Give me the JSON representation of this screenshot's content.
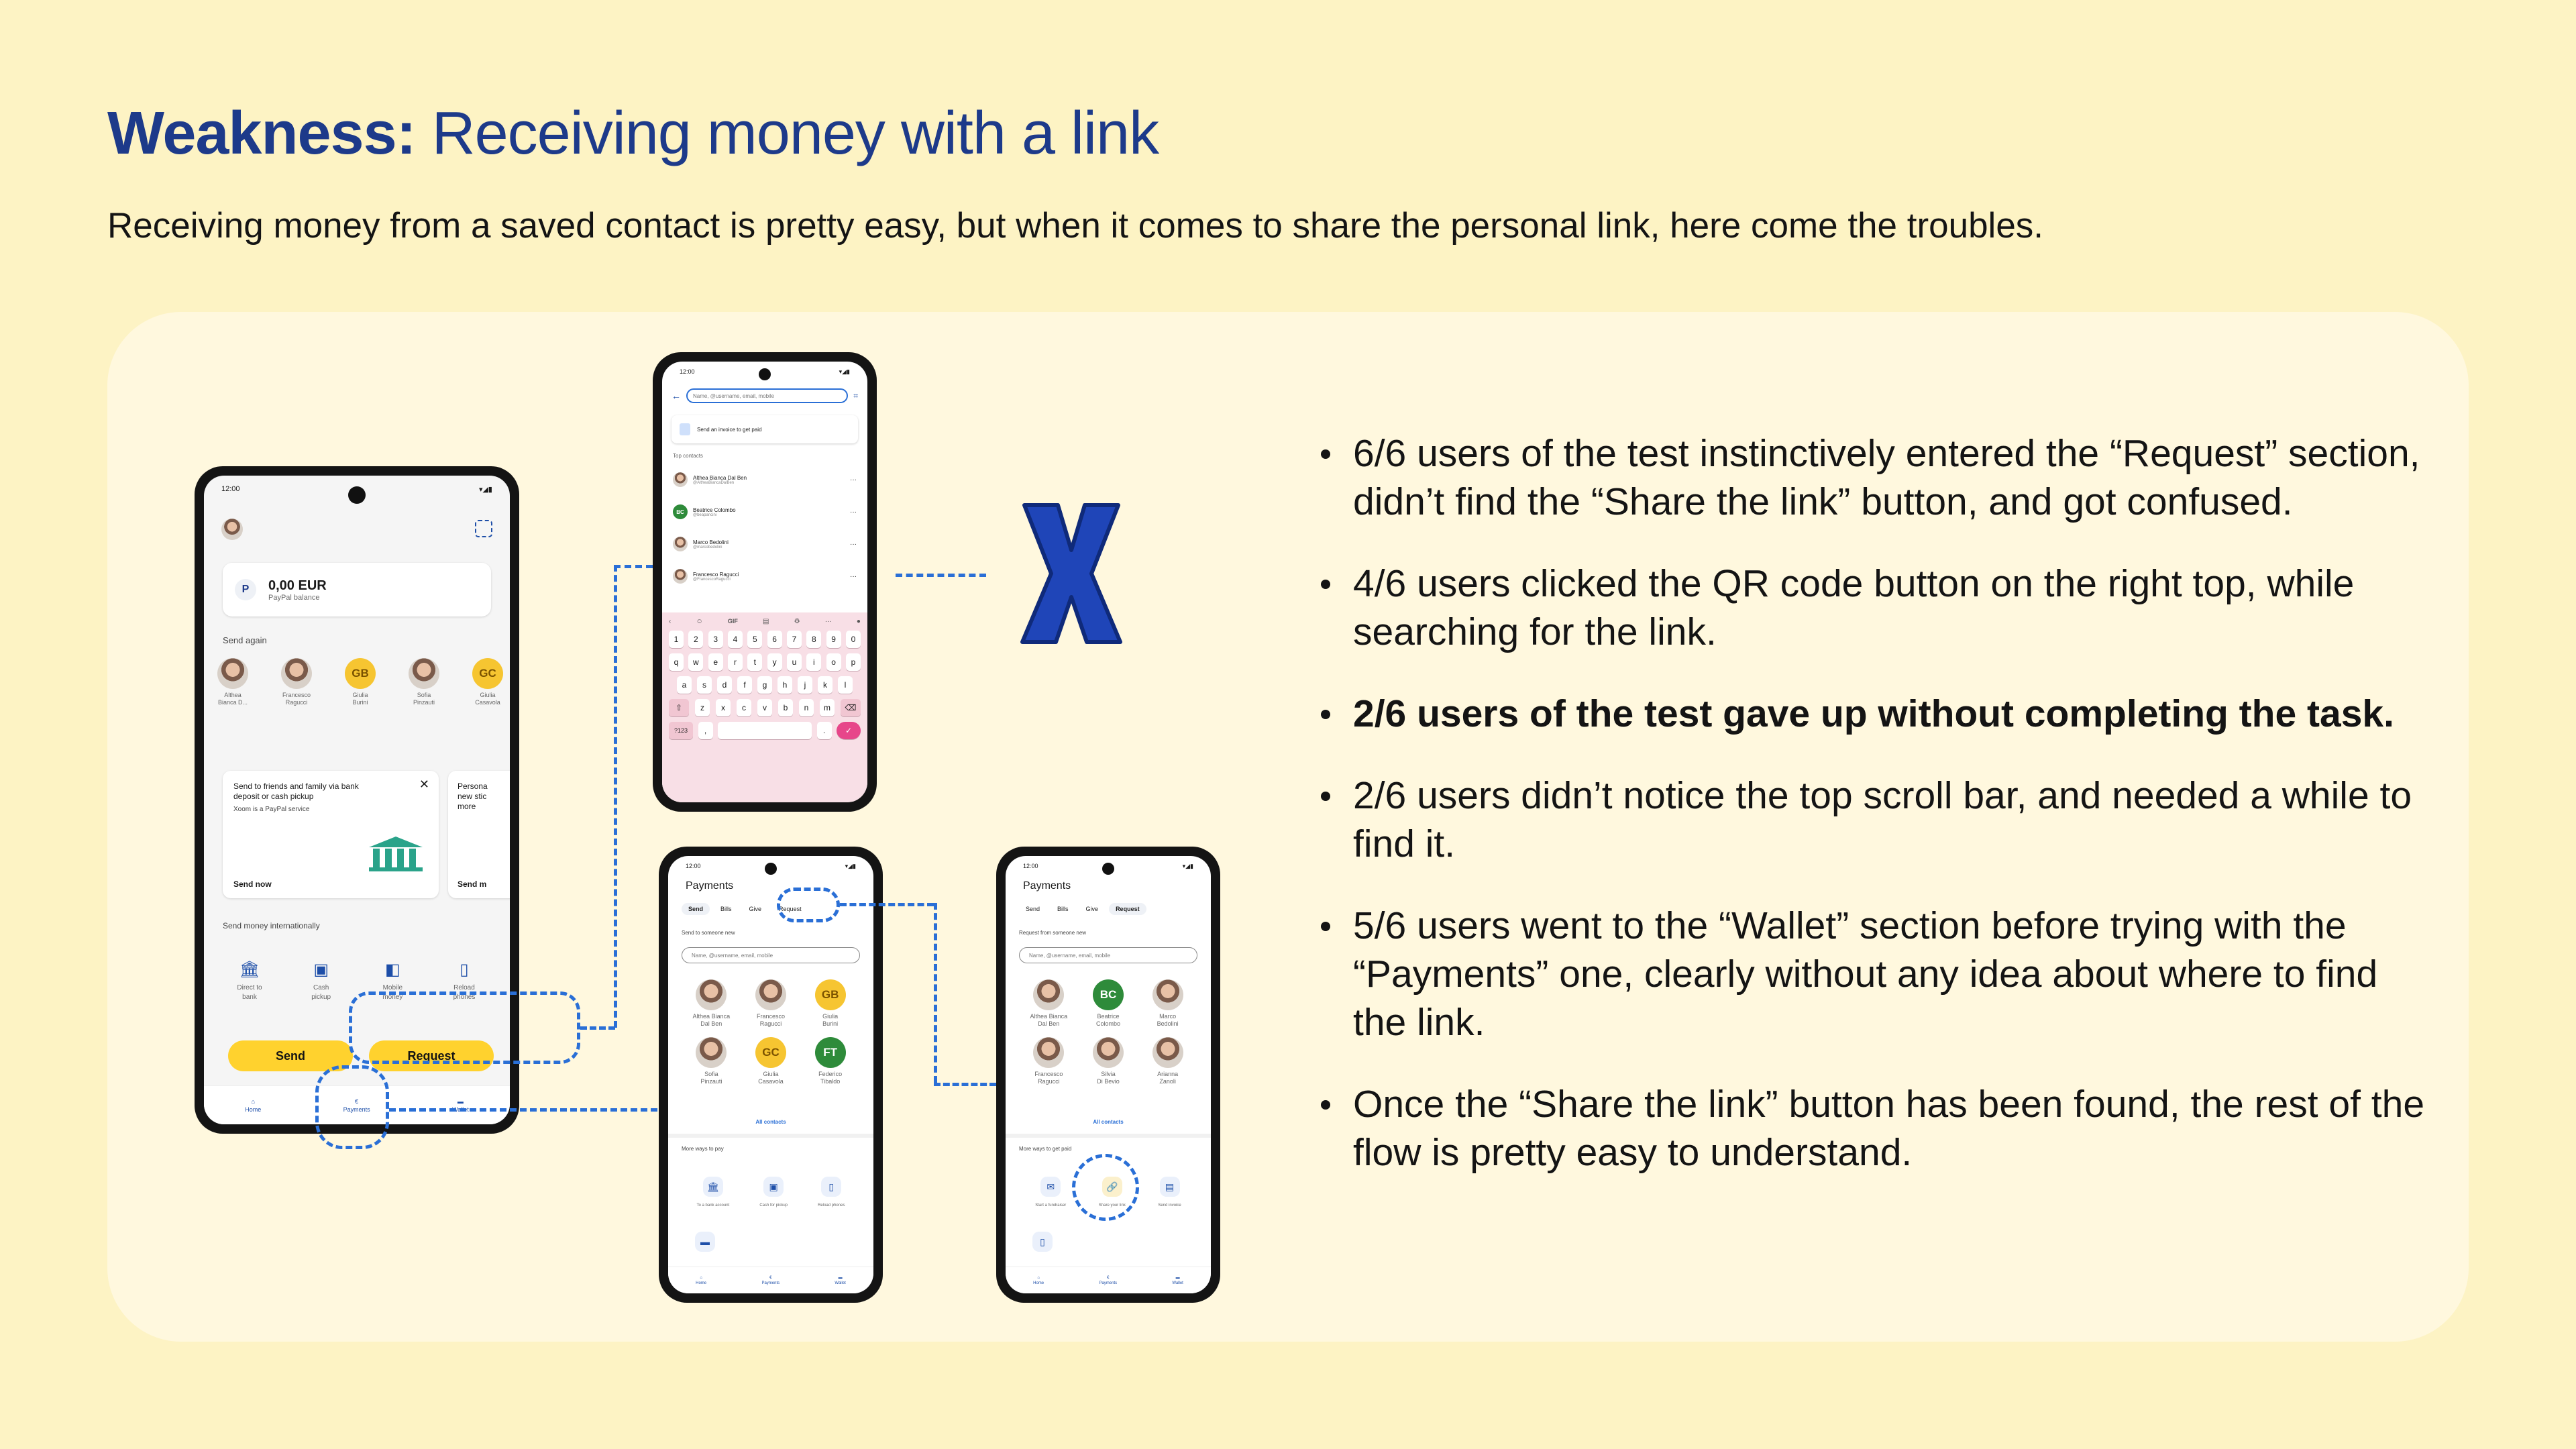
{
  "header": {
    "title_bold": "Weakness:",
    "title_rest": " Receiving money with a link",
    "subtitle": "Receiving money from a saved contact is pretty easy, but when it comes to share the personal link, here come the troubles."
  },
  "colors": {
    "background": "#fdf3c4",
    "panel": "#fff8de",
    "title": "#1d3a8a",
    "accent": "#2a6fd6",
    "x_mark": "#1f45b8",
    "button": "#ffd22e"
  },
  "phone_home": {
    "time": "12:00",
    "balance": "0,00 EUR",
    "balance_label": "PayPal balance",
    "send_again_label": "Send again",
    "contacts": [
      {
        "name": "Althea\nBianca D...",
        "initials": ""
      },
      {
        "name": "Francesco\nRagucci",
        "initials": ""
      },
      {
        "name": "Giulia\nBurini",
        "initials": "GB"
      },
      {
        "name": "Sofia\nPinzauti",
        "initials": ""
      },
      {
        "name": "Giulia\nCasavola",
        "initials": "GC"
      }
    ],
    "promo_text": "Send to friends and family via bank deposit or cash pickup",
    "promo_sub": "Xoom is a PayPal service",
    "promo_cta": "Send now",
    "promo2_text": "Persona new stic more",
    "promo2_cta": "Send m",
    "intl_label": "Send money internationally",
    "intl_items": [
      "Direct to\nbank",
      "Cash\npickup",
      "Mobile\nmoney",
      "Reload\nphones"
    ],
    "send_btn": "Send",
    "request_btn": "Request",
    "nav": [
      "Home",
      "Payments",
      "Wallet"
    ]
  },
  "phone_search": {
    "time": "12:00",
    "search_placeholder": "Name, @username, email, mobile",
    "invoice_label": "Send an invoice to get paid",
    "top_contacts_label": "Top contacts",
    "contacts": [
      {
        "name": "Althea Bianca Dal Ben",
        "handle": "@AltheaBiancaDalBen"
      },
      {
        "name": "Beatrice Colombo",
        "handle": "@beapancini",
        "initials": "BC"
      },
      {
        "name": "Marco Bedolini",
        "handle": "@marcobedolini"
      },
      {
        "name": "Francesco Ragucci",
        "handle": "@FrancescoRagucci"
      }
    ],
    "kb_row1": [
      "1",
      "2",
      "3",
      "4",
      "5",
      "6",
      "7",
      "8",
      "9",
      "0"
    ],
    "kb_row2": [
      "q",
      "w",
      "e",
      "r",
      "t",
      "y",
      "u",
      "i",
      "o",
      "p"
    ],
    "kb_row3": [
      "a",
      "s",
      "d",
      "f",
      "g",
      "h",
      "j",
      "k",
      "l"
    ],
    "kb_row4": [
      "z",
      "x",
      "c",
      "v",
      "b",
      "n",
      "m"
    ],
    "kb_sym": "?123",
    "kb_gif": "GIF"
  },
  "phone_pay_send": {
    "time": "12:00",
    "title": "Payments",
    "tabs": [
      "Send",
      "Bills",
      "Give",
      "Request"
    ],
    "section": "Send to someone new",
    "search_placeholder": "Name, @username, email, mobile",
    "contacts": [
      {
        "name": "Althea Bianca\nDal Ben",
        "initials": ""
      },
      {
        "name": "Francesco\nRagucci",
        "initials": ""
      },
      {
        "name": "Giulia\nBurini",
        "initials": "GB"
      },
      {
        "name": "Sofia\nPinzauti",
        "initials": ""
      },
      {
        "name": "Giulia\nCasavola",
        "initials": "GC"
      },
      {
        "name": "Federico\nTibaldo",
        "initials": "FT"
      }
    ],
    "all_contacts": "All contacts",
    "more_label": "More ways to pay",
    "more_items": [
      "To a bank account",
      "Cash for pickup",
      "Reload phones"
    ],
    "nav": [
      "Home",
      "Payments",
      "Wallet"
    ]
  },
  "phone_pay_request": {
    "time": "12:00",
    "title": "Payments",
    "tabs": [
      "Send",
      "Bills",
      "Give",
      "Request"
    ],
    "section": "Request from someone new",
    "search_placeholder": "Name, @username, email, mobile",
    "contacts": [
      {
        "name": "Althea Bianca\nDal Ben",
        "initials": ""
      },
      {
        "name": "Beatrice\nColombo",
        "initials": "BC"
      },
      {
        "name": "Marco\nBedolini",
        "initials": ""
      },
      {
        "name": "Francesco\nRagucci",
        "initials": ""
      },
      {
        "name": "Silvia\nDi Bevio",
        "initials": ""
      },
      {
        "name": "Arianna\nZanoli",
        "initials": ""
      }
    ],
    "all_contacts": "All contacts",
    "more_label": "More ways to get paid",
    "more_items": [
      "Start a fundraiser",
      "Share your link",
      "Send invoice"
    ],
    "nav": [
      "Home",
      "Payments",
      "Wallet"
    ]
  },
  "findings": [
    {
      "text": "6/6 users of the test instinctively entered the “Request” section, didn’t find the “Share the link” button, and got confused.",
      "bold": false
    },
    {
      "text": "4/6 users clicked the QR code button on the right top, while searching for the link.",
      "bold": false
    },
    {
      "text": "2/6 users of the test gave up without completing the task.",
      "bold": true
    },
    {
      "text": "2/6 users didn’t notice the top scroll bar, and needed a while to find it.",
      "bold": false
    },
    {
      "text": "5/6 users went to the “Wallet” section before trying with the “Payments” one, clearly without any idea about where to find the link.",
      "bold": false
    },
    {
      "text": "Once the “Share the link” button has been found, the rest of the flow is pretty easy to understand.",
      "bold": false
    }
  ]
}
